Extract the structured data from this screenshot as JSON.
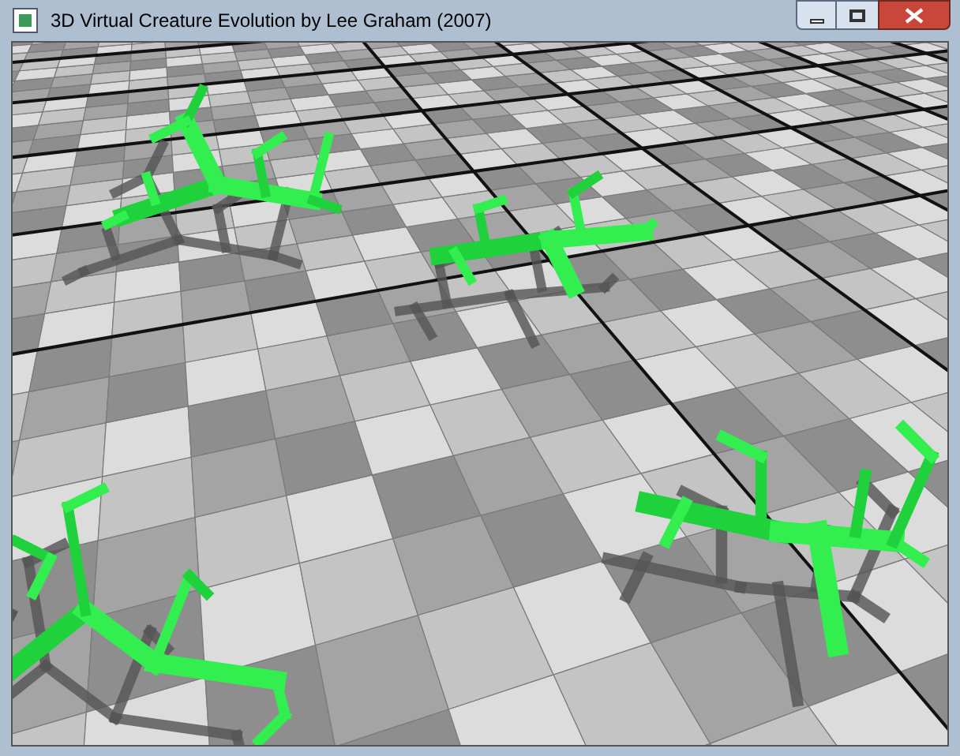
{
  "window": {
    "title": "3D Virtual Creature Evolution by Lee Graham (2007)"
  }
}
